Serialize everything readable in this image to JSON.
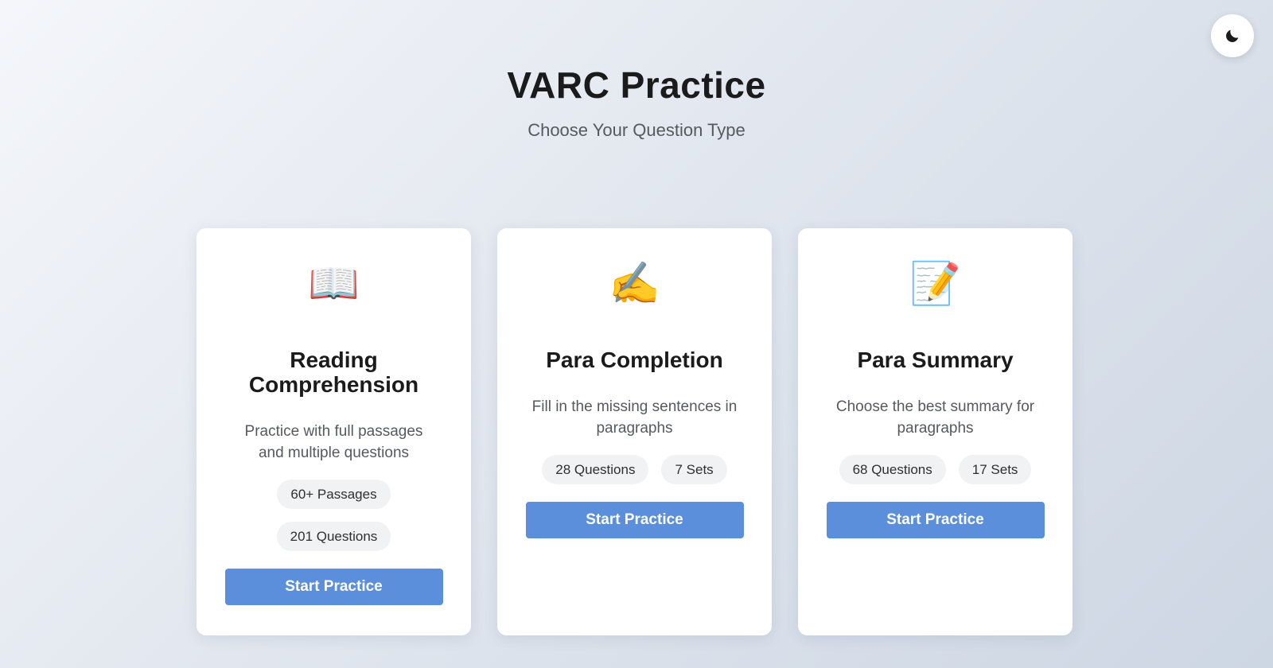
{
  "header": {
    "title": "VARC Practice",
    "subtitle": "Choose Your Question Type"
  },
  "theme_toggle": {
    "icon": "moon-icon"
  },
  "colors": {
    "button": "#5b8fdc",
    "card_bg": "#ffffff",
    "badge_bg": "#f1f2f4"
  },
  "cards": [
    {
      "icon": "open-book-icon",
      "icon_glyph": "📖",
      "title": "Reading Comprehension",
      "description": "Practice with full passages and multiple questions",
      "badges": [
        "60+ Passages",
        "201 Questions"
      ],
      "button_label": "Start Practice"
    },
    {
      "icon": "writing-hand-icon",
      "icon_glyph": "✍️",
      "title": "Para Completion",
      "description": "Fill in the missing sentences in paragraphs",
      "badges": [
        "28 Questions",
        "7 Sets"
      ],
      "button_label": "Start Practice"
    },
    {
      "icon": "memo-icon",
      "icon_glyph": "📝",
      "title": "Para Summary",
      "description": "Choose the best summary for paragraphs",
      "badges": [
        "68 Questions",
        "17 Sets"
      ],
      "button_label": "Start Practice"
    }
  ]
}
